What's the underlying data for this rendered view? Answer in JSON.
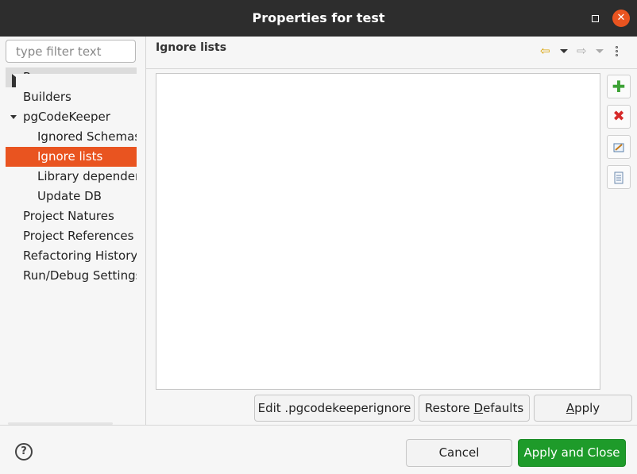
{
  "window": {
    "title": "Properties for test",
    "close_glyph": "✕"
  },
  "filter": {
    "placeholder": "type filter text"
  },
  "tree": {
    "items": [
      {
        "label": "Resource"
      },
      {
        "label": "Builders"
      },
      {
        "label": "pgCodeKeeper"
      },
      {
        "label": "Ignored Schemas"
      },
      {
        "label": "Ignore lists"
      },
      {
        "label": "Library dependen"
      },
      {
        "label": "Update DB"
      },
      {
        "label": "Project Natures"
      },
      {
        "label": "Project References"
      },
      {
        "label": "Refactoring History"
      },
      {
        "label": "Run/Debug Settings"
      }
    ],
    "selected": "Ignore lists"
  },
  "page": {
    "title": "Ignore lists",
    "side_buttons": {
      "add": {
        "glyph": "✚",
        "icon": "add-icon"
      },
      "remove": {
        "glyph": "✖",
        "icon": "remove-icon"
      },
      "edit": {
        "icon": "edit-icon"
      },
      "doc": {
        "icon": "document-icon"
      }
    },
    "nav": {
      "back": "⇦",
      "forward": "⇨"
    },
    "buttons": {
      "edit_file": "Edit .pgcodekeeperignore",
      "restore_prefix": "Restore ",
      "restore_underline": "D",
      "restore_suffix": "efaults",
      "apply_underline": "A",
      "apply_suffix": "pply"
    }
  },
  "footer": {
    "help": "?",
    "cancel": "Cancel",
    "apply_and_close": "Apply and Close"
  },
  "colors": {
    "accent": "#e95420",
    "primary_button": "#1e9b2a",
    "titlebar": "#2d2d2d"
  }
}
